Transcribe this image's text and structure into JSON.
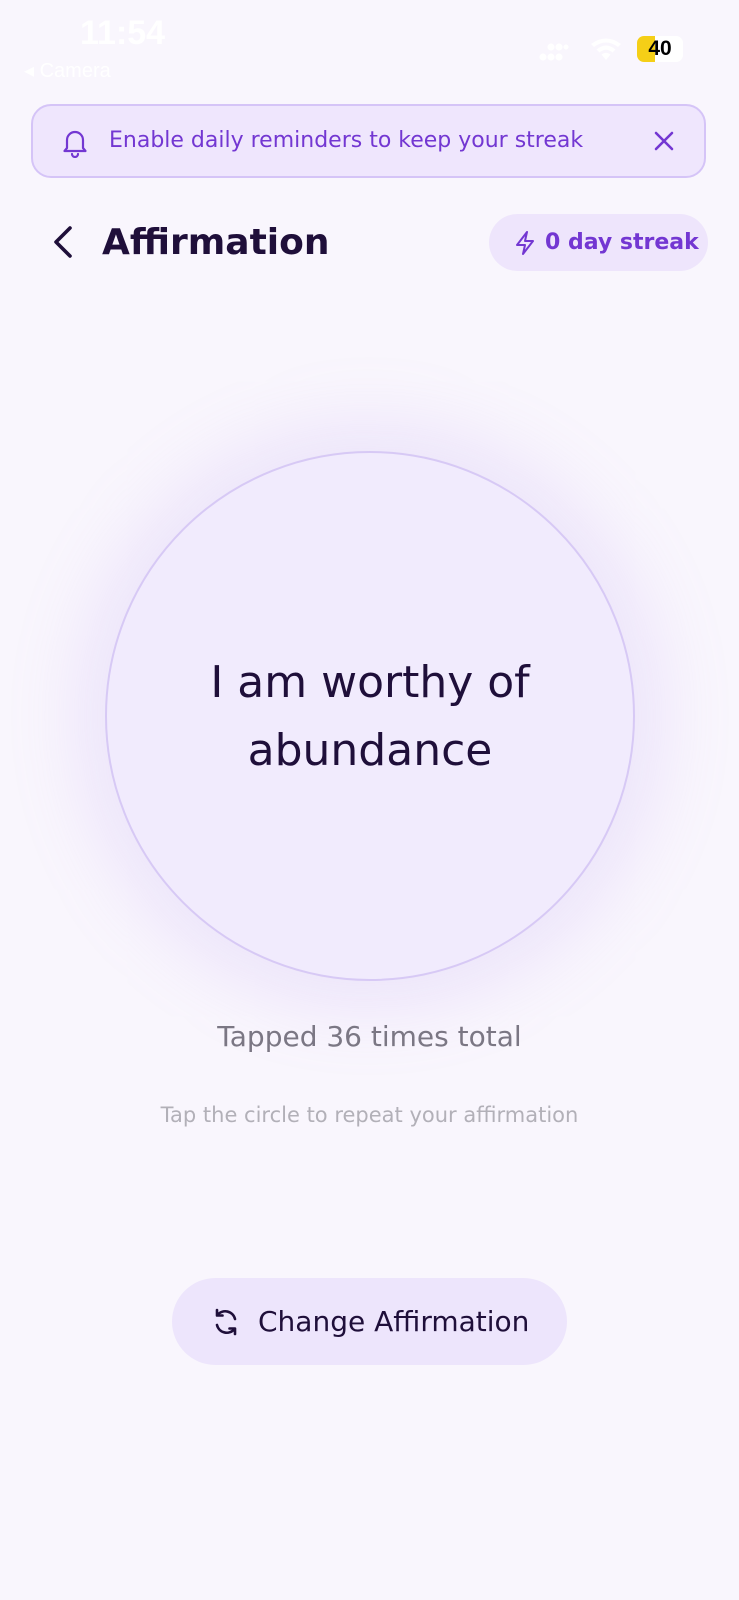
{
  "status_bar": {
    "time": "11:54",
    "back_app": "◂ Camera",
    "battery_level": "40",
    "battery_fraction": 0.4
  },
  "banner": {
    "text": "Enable daily reminders to keep your streak",
    "icon": "bell-icon",
    "close_icon": "close-icon"
  },
  "header": {
    "title": "Affirmation",
    "back_icon": "chevron-left-icon",
    "streak_icon": "lightning-icon",
    "streak_label": "0 day streak"
  },
  "affirmation": {
    "text": "I am worthy of abundance"
  },
  "stats": {
    "tap_count_text": "Tapped 36 times total",
    "hint": "Tap the circle to repeat your affirmation"
  },
  "actions": {
    "change_label": "Change Affirmation",
    "change_icon": "refresh-icon"
  },
  "colors": {
    "background": "#f9f6fd",
    "accent": "#7337d2",
    "text_dark": "#1f0f3a",
    "banner_bg": "#efe6fd",
    "circle_bg": "#f1ebfd",
    "battery": "#f5cf17"
  }
}
